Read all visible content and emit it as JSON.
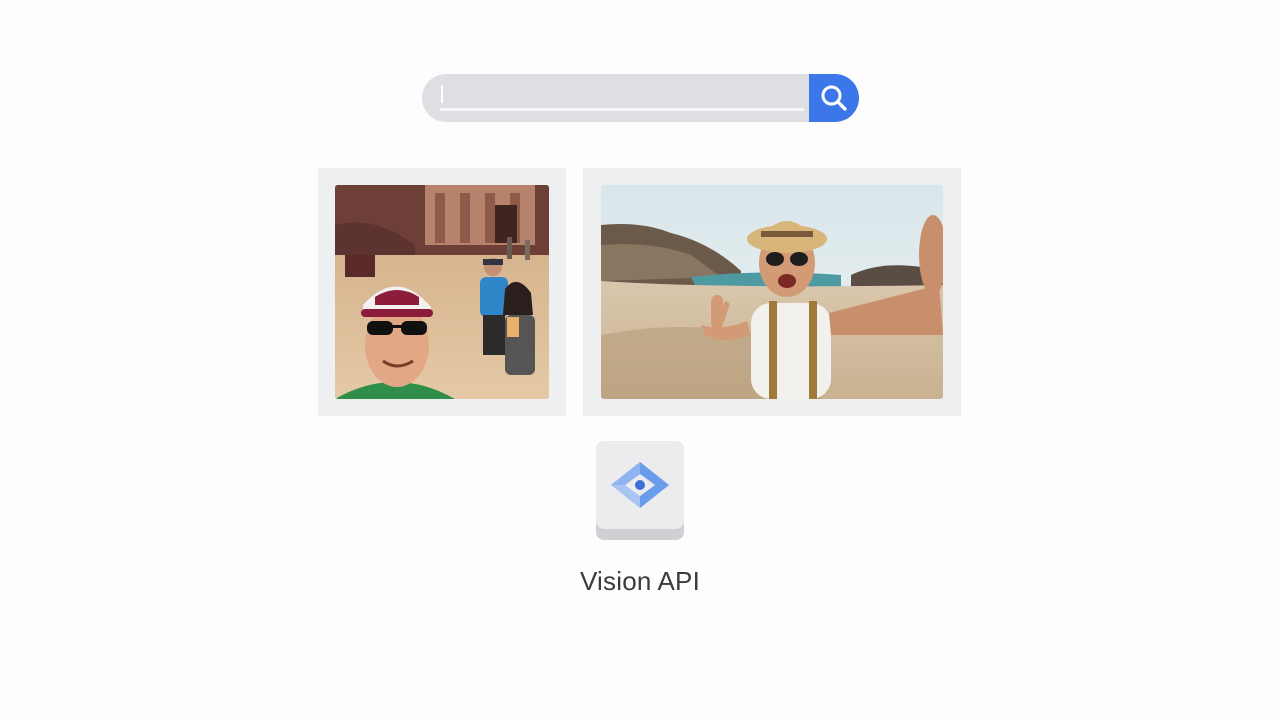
{
  "search": {
    "value": "",
    "placeholder": "",
    "button_icon": "search-icon"
  },
  "results": [
    {
      "name": "petra-selfie-photo",
      "icon": "photo"
    },
    {
      "name": "beach-selfie-photo",
      "icon": "photo"
    }
  ],
  "api_tile": {
    "icon": "vision-api-icon",
    "label": "Vision API"
  },
  "colors": {
    "accent": "#3b77e8",
    "search_bg": "#dedfe2",
    "card_bg": "#eeeff1",
    "label_text": "#3a3b3d"
  }
}
